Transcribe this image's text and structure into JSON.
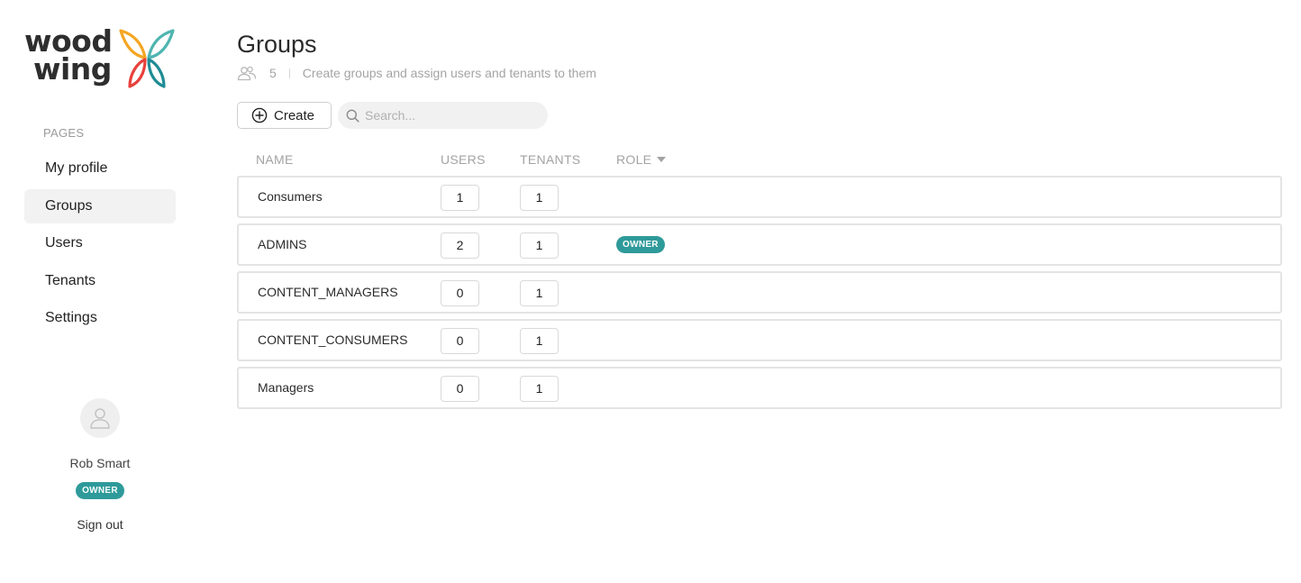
{
  "brand": {
    "line1": "wood",
    "line2": "wing",
    "colors": {
      "orange": "#f5a623",
      "red": "#e8413c",
      "teal": "#2f9a9a"
    }
  },
  "sidebar": {
    "section_label": "PAGES",
    "items": [
      {
        "label": "My profile",
        "active": false
      },
      {
        "label": "Groups",
        "active": true
      },
      {
        "label": "Users",
        "active": false
      },
      {
        "label": "Tenants",
        "active": false
      },
      {
        "label": "Settings",
        "active": false
      }
    ],
    "user": {
      "name": "Rob Smart",
      "role": "OWNER",
      "sign_out": "Sign out"
    }
  },
  "main": {
    "title": "Groups",
    "count": "5",
    "description": "Create groups and assign users and tenants to them",
    "create_label": "Create",
    "search_placeholder": "Search..."
  },
  "table": {
    "columns": {
      "name": "NAME",
      "users": "USERS",
      "tenants": "TENANTS",
      "role": "ROLE"
    },
    "rows": [
      {
        "name": "Consumers",
        "users": "1",
        "tenants": "1",
        "role": ""
      },
      {
        "name": "ADMINS",
        "users": "2",
        "tenants": "1",
        "role": "OWNER"
      },
      {
        "name": "CONTENT_MANAGERS",
        "users": "0",
        "tenants": "1",
        "role": ""
      },
      {
        "name": "CONTENT_CONSUMERS",
        "users": "0",
        "tenants": "1",
        "role": ""
      },
      {
        "name": "Managers",
        "users": "0",
        "tenants": "1",
        "role": ""
      }
    ]
  }
}
